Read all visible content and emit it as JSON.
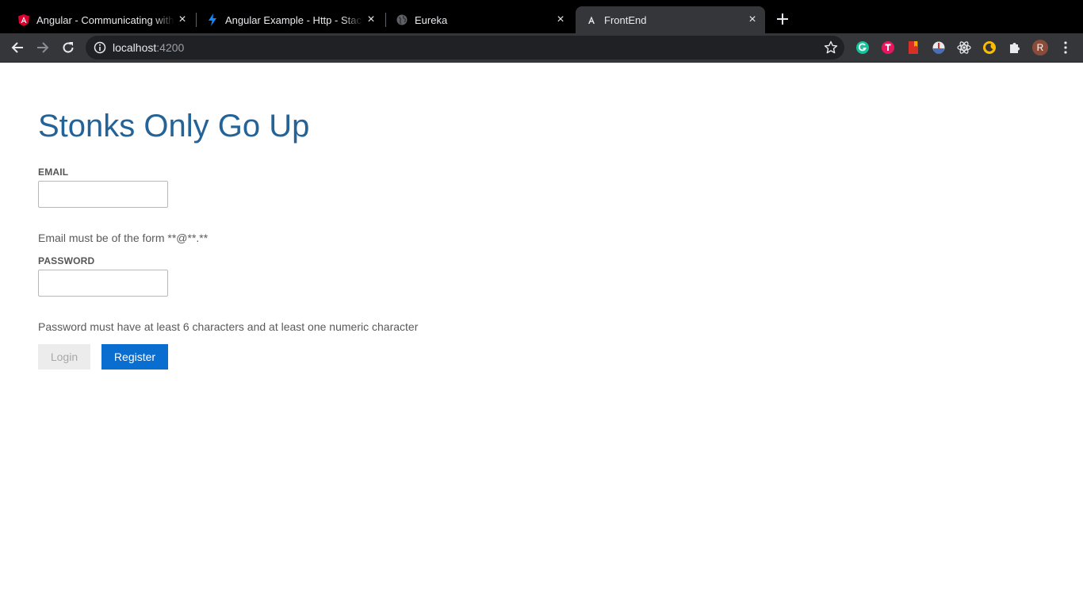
{
  "browser": {
    "tabs": [
      {
        "title": "Angular - Communicating with",
        "icon": "angular-icon",
        "active": false
      },
      {
        "title": "Angular Example - Http - Stack",
        "icon": "stackblitz-icon",
        "active": false
      },
      {
        "title": "Eureka",
        "icon": "globe-icon",
        "active": false
      },
      {
        "title": "FrontEnd",
        "icon": "angular-icon",
        "active": true
      }
    ],
    "tab_close": "×",
    "url_host": "localhost",
    "url_port": ":4200",
    "profile_initial": "R",
    "extensions": [
      "grammarly-icon",
      "todoist-icon",
      "bookmark-icon",
      "extension-icon",
      "react-devtools-icon",
      "moon-icon",
      "puzzle-icon"
    ]
  },
  "app": {
    "title": "Stonks Only Go Up",
    "email": {
      "label": "EMAIL",
      "value": "",
      "hint": "Email must be of the form **@**.**"
    },
    "password": {
      "label": "PASSWORD",
      "value": "",
      "hint": "Password must have at least 6 characters and at least one numeric character"
    },
    "login_label": "Login",
    "register_label": "Register",
    "colors": {
      "title": "#236397",
      "register": "#0a6ed1",
      "login_disabled_bg": "#ececec",
      "login_disabled_text": "#a8a8a8"
    }
  }
}
